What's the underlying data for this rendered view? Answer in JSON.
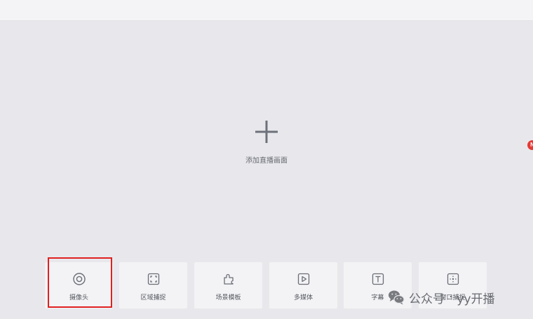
{
  "canvas": {
    "add_label": "添加直播画面"
  },
  "toolbar": {
    "items": [
      {
        "label": "摄像头",
        "icon": "camera-lens-icon"
      },
      {
        "label": "区域捕捉",
        "icon": "region-capture-icon"
      },
      {
        "label": "场景模板",
        "icon": "scene-template-icon"
      },
      {
        "label": "多媒体",
        "icon": "multimedia-play-icon"
      },
      {
        "label": "字幕",
        "icon": "text-caption-icon"
      },
      {
        "label": "窗口捕捉",
        "icon": "window-capture-icon"
      }
    ],
    "highlighted_index": 0
  },
  "side_badge": "N",
  "watermark": {
    "source": "公众号",
    "separator": "·",
    "account": "yy开播"
  },
  "colors": {
    "background": "#e8e8ec",
    "card": "#f3f3f5",
    "highlight": "#e02020",
    "badge": "#e53935"
  }
}
